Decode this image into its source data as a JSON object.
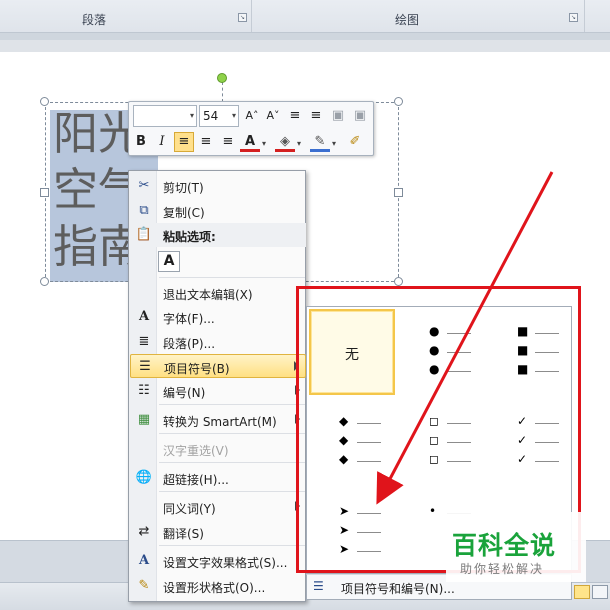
{
  "ribbon": {
    "group_paragraph": "段落",
    "group_drawing": "绘图",
    "launcher_symbol": "↘"
  },
  "textbox": {
    "lines": [
      "阳光",
      "空气",
      "指南"
    ]
  },
  "mini_toolbar": {
    "font_name": "",
    "font_size": "54",
    "dropdown_symbol": "▾",
    "grow_font": "A˄",
    "shrink_font": "A˅",
    "bold": "B",
    "italic": "I",
    "align_left": "≡",
    "align_center": "≡",
    "align_right": "≡",
    "font_color": "A",
    "highlight": "◈",
    "outline": "✎",
    "format_painter": "✐",
    "colors": {
      "font_color": "#d42020",
      "fill": "#d42020",
      "outline": "#3b6fd0"
    }
  },
  "context_menu": {
    "cut": "剪切(T)",
    "copy": "复制(C)",
    "paste_options": "粘贴选项:",
    "paste_keep_text": "A",
    "exit_edit": "退出文本编辑(X)",
    "font": "字体(F)...",
    "paragraph": "段落(P)...",
    "bullets": "项目符号(B)",
    "numbering": "编号(N)",
    "convert_smartart": "转换为 SmartArt(M)",
    "hanzi_reselect": "汉字重选(V)",
    "hyperlink": "超链接(H)...",
    "synonyms": "同义词(Y)",
    "translate": "翻译(S)",
    "text_effects": "设置文字效果格式(S)...",
    "shape_format": "设置形状格式(O)..."
  },
  "bullet_gallery": {
    "none_label": "无",
    "symbols": {
      "filled_round": "●",
      "filled_square": "■",
      "diamond": "◆",
      "hollow_square": "◻",
      "check": "✓",
      "arrow": "➤",
      "small_dot": "•"
    },
    "footer_label": "项目符号和编号(N)..."
  },
  "watermark": {
    "title": "百科全说",
    "subtitle": "助你轻松解决"
  },
  "colors": {
    "annotation_red": "#e0141b",
    "menu_highlight": "#ffe083",
    "selected_border": "#f4c64a",
    "watermark_green": "#1aa33b"
  }
}
